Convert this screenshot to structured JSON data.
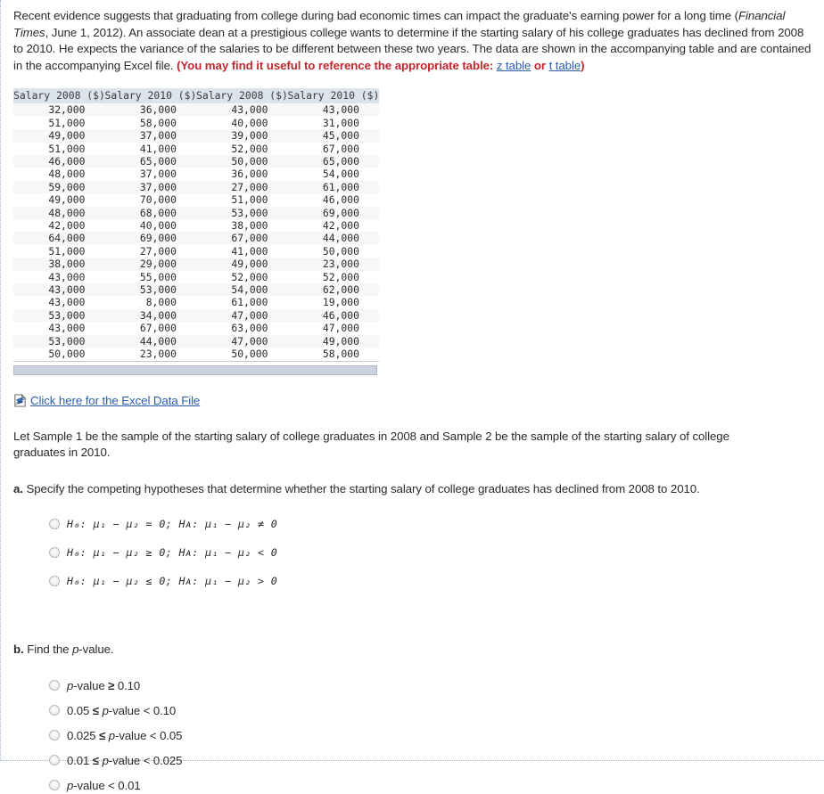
{
  "intro": {
    "before_ft": "Recent evidence suggests that graduating from college during bad economic times can impact the graduate's earning power for a long time (",
    "ft_italic": "Financial Times",
    "after_ft": ", June 1, 2012). An associate dean at a prestigious college wants to determine if the starting salary of his college graduates has declined from 2008 to 2010. He expects the variance of the salaries to be different between these two years. The data are shown in the accompanying table and are contained in the accompanying Excel file. ",
    "hint_open": "(You may find it useful to reference the appropriate table: ",
    "z_table_link": "z table",
    "or_text": " or ",
    "t_table_link": "t table",
    "hint_close": ")"
  },
  "table": {
    "headers": [
      "Salary 2008 ($)",
      "Salary 2010 ($)",
      "Salary 2008 ($)",
      "Salary 2010 ($)"
    ],
    "rows": [
      [
        "32,000",
        "36,000",
        "43,000",
        "43,000"
      ],
      [
        "51,000",
        "58,000",
        "40,000",
        "31,000"
      ],
      [
        "49,000",
        "37,000",
        "39,000",
        "45,000"
      ],
      [
        "51,000",
        "41,000",
        "52,000",
        "67,000"
      ],
      [
        "46,000",
        "65,000",
        "50,000",
        "65,000"
      ],
      [
        "48,000",
        "37,000",
        "36,000",
        "54,000"
      ],
      [
        "59,000",
        "37,000",
        "27,000",
        "61,000"
      ],
      [
        "49,000",
        "70,000",
        "51,000",
        "46,000"
      ],
      [
        "48,000",
        "68,000",
        "53,000",
        "69,000"
      ],
      [
        "42,000",
        "40,000",
        "38,000",
        "42,000"
      ],
      [
        "64,000",
        "69,000",
        "67,000",
        "44,000"
      ],
      [
        "51,000",
        "27,000",
        "41,000",
        "50,000"
      ],
      [
        "38,000",
        "29,000",
        "49,000",
        "23,000"
      ],
      [
        "43,000",
        "55,000",
        "52,000",
        "52,000"
      ],
      [
        "43,000",
        "53,000",
        "54,000",
        "62,000"
      ],
      [
        "43,000",
        "8,000",
        "61,000",
        "19,000"
      ],
      [
        "53,000",
        "34,000",
        "47,000",
        "46,000"
      ],
      [
        "43,000",
        "67,000",
        "63,000",
        "47,000"
      ],
      [
        "53,000",
        "44,000",
        "47,000",
        "49,000"
      ],
      [
        "50,000",
        "23,000",
        "50,000",
        "58,000"
      ]
    ]
  },
  "excel": {
    "icon": "excel-file-icon",
    "link_text": "Click here for the Excel Data File"
  },
  "sample_note": "Let Sample 1 be the sample of the starting salary of college graduates in 2008 and Sample 2 be the sample of the starting salary of college graduates in 2010.",
  "part_a": {
    "label": "a.",
    "text": " Specify the competing hypotheses that determine whether the starting salary of college graduates has declined from 2008 to 2010.",
    "options": [
      "H₀: μ₁ − μ₂ = 0; Hᴀ: μ₁ − μ₂ ≠ 0",
      "H₀: μ₁ − μ₂ ≥ 0; Hᴀ: μ₁ − μ₂ < 0",
      "H₀: μ₁ − μ₂ ≤ 0; Hᴀ: μ₁ − μ₂ > 0"
    ]
  },
  "part_b": {
    "label": "b.",
    "text_before": " Find the ",
    "text_italic": "p",
    "text_after": "-value.",
    "options": [
      {
        "pre": "",
        "pv": "p",
        "mid": "-value ",
        "ineq": "≥",
        "post": " 0.10"
      },
      {
        "pre": "0.05 ",
        "ineq": "≤",
        "mid2": " ",
        "pv": "p",
        "post": "-value < 0.10"
      },
      {
        "pre": "0.025 ",
        "ineq": "≤",
        "mid2": " ",
        "pv": "p",
        "post": "-value < 0.05"
      },
      {
        "pre": "0.01 ",
        "ineq": "≤",
        "mid2": " ",
        "pv": "p",
        "post": "-value < 0.025"
      },
      {
        "pre": "",
        "pv": "p",
        "post": "-value < 0.01"
      }
    ]
  },
  "colors": {
    "hint_red": "#c1272d",
    "link_blue": "#2a5db0",
    "header_bg": "#dde3ed",
    "row_alt": "#f7f7f7"
  }
}
